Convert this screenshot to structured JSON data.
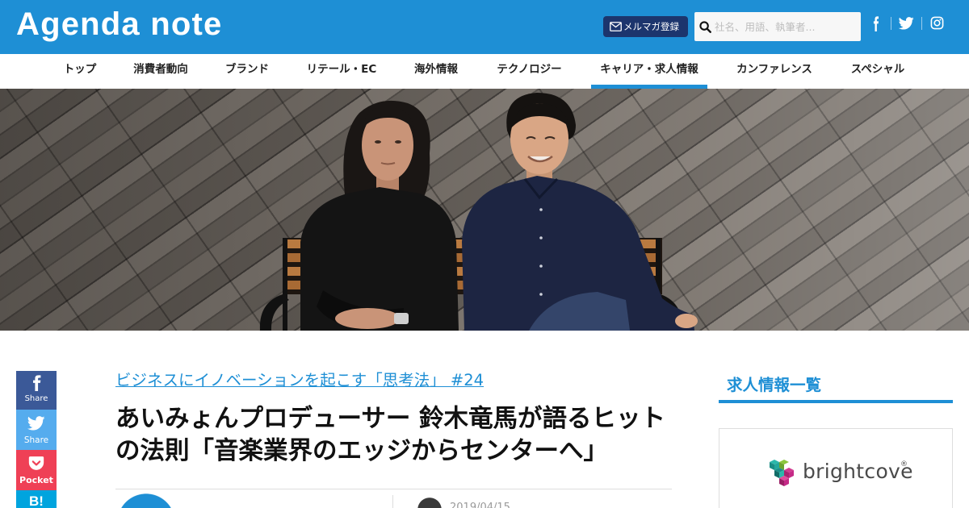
{
  "header": {
    "logo": "Agenda note",
    "newsletter": {
      "label": "メルマガ登録",
      "icon": "mail-icon"
    },
    "search": {
      "placeholder": "社名、用語、執筆者...",
      "icon": "search-icon"
    },
    "social": [
      {
        "icon": "facebook-icon"
      },
      {
        "icon": "twitter-icon"
      },
      {
        "icon": "instagram-icon"
      }
    ]
  },
  "nav": {
    "items": [
      {
        "label": "トップ"
      },
      {
        "label": "消費者動向"
      },
      {
        "label": "ブランド"
      },
      {
        "label": "リテール・EC"
      },
      {
        "label": "海外情報"
      },
      {
        "label": "テクノロジー"
      },
      {
        "label": "キャリア・求人情報",
        "active": true
      },
      {
        "label": "カンファレンス"
      },
      {
        "label": "スペシャル"
      }
    ]
  },
  "share": [
    {
      "icon": "facebook-icon",
      "label": "Share",
      "color": "#3b5998"
    },
    {
      "icon": "twitter-icon",
      "label": "Share",
      "color": "#55acee"
    },
    {
      "icon": "pocket-icon",
      "label": "Pocket",
      "color": "#ef4056"
    },
    {
      "icon": "hatena-bookmark-icon",
      "label": "B!",
      "color": "#00a4de"
    }
  ],
  "article": {
    "category": "ビジネスにイノベーションを起こす「思考法」 #24",
    "title": "あいみょんプロデューサー 鈴木竜馬が語るヒットの法則「音楽業界のエッジからセンターへ」",
    "date": "2019/04/15"
  },
  "sidebar": {
    "heading": "求人情報一覧",
    "ad": {
      "brand": "brightcove",
      "trademark": "®",
      "icon": "brightcove-logo-icon"
    }
  },
  "colors": {
    "brand": "#1e8fd5",
    "newsletter_button": "#1c356d",
    "title_text": "#111111"
  }
}
